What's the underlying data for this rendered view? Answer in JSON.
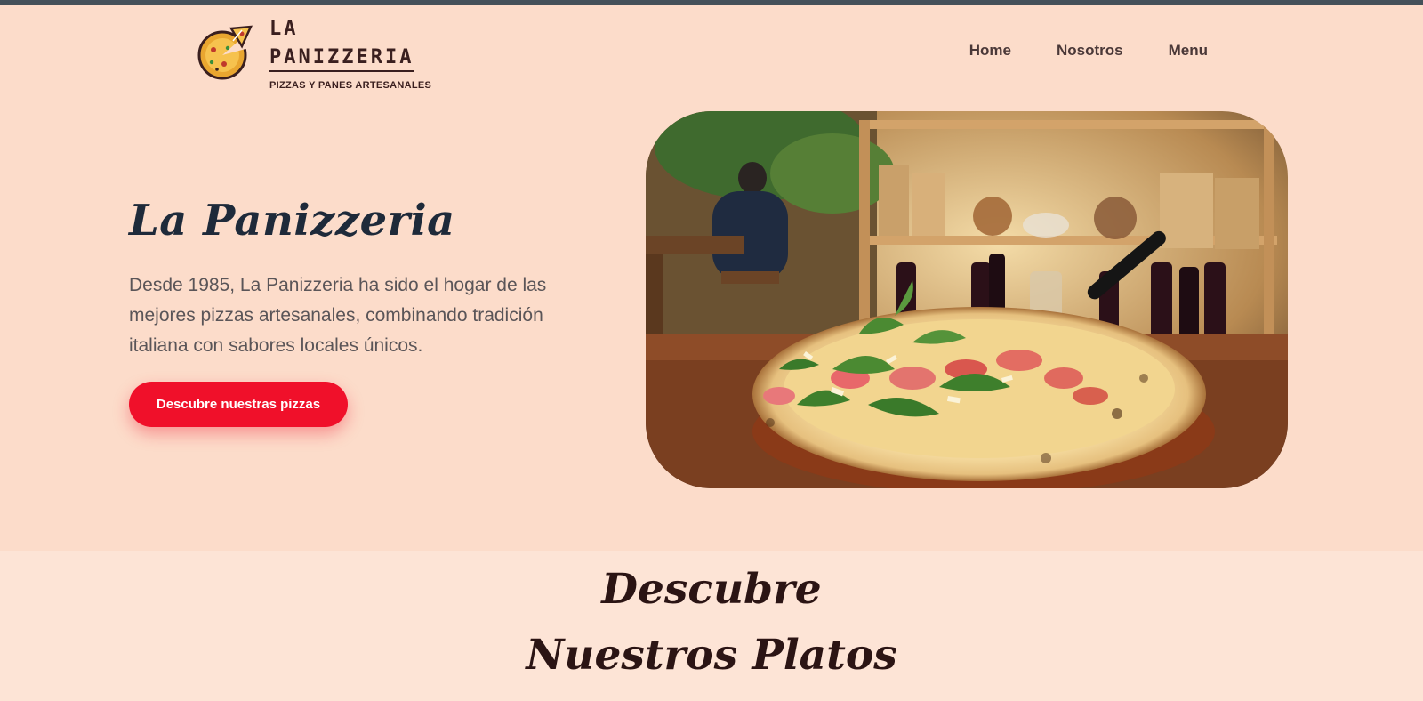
{
  "brand": {
    "name_line1": "LA",
    "name_line2": "PANIZZERIA",
    "tagline": "PIZZAS Y PANES ARTESANALES"
  },
  "nav": {
    "items": [
      {
        "label": "Home"
      },
      {
        "label": "Nosotros"
      },
      {
        "label": "Menu"
      }
    ]
  },
  "hero": {
    "title": "La Panizzeria",
    "description": "Desde 1985, La Panizzeria ha sido el hogar de las mejores pizzas artesanales, combinando tradición italiana con sabores locales únicos.",
    "cta_label": "Descubre nuestras pizzas"
  },
  "section": {
    "title_line1": "Descubre",
    "title_line2": "Nuestros Platos"
  },
  "colors": {
    "topbar": "#44515a",
    "header_bg": "#fcdcca",
    "page_bg": "#fde4d6",
    "accent": "#f0102a",
    "title": "#1e2a3a"
  },
  "icons": {
    "logo": "pizza-icon"
  }
}
